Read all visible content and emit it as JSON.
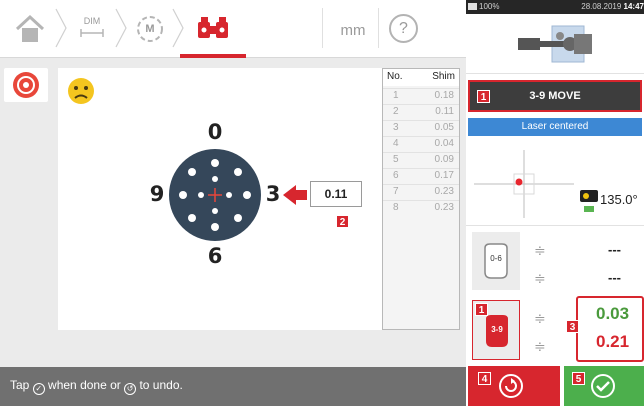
{
  "toolbar": {
    "dim_label": "DIM",
    "m_label": "M",
    "units": "mm",
    "help": "?"
  },
  "diagram": {
    "label_top": "0",
    "label_left": "9",
    "label_right": "3",
    "label_bottom": "6",
    "shim_value": "0.11",
    "badge": "2",
    "face": "frown-face-icon"
  },
  "shim_table": {
    "header_no": "No.",
    "header_shim": "Shim",
    "rows": [
      {
        "no": "1",
        "shim": "0.18"
      },
      {
        "no": "2",
        "shim": "0.11"
      },
      {
        "no": "3",
        "shim": "0.05"
      },
      {
        "no": "4",
        "shim": "0.04"
      },
      {
        "no": "5",
        "shim": "0.09"
      },
      {
        "no": "6",
        "shim": "0.17"
      },
      {
        "no": "7",
        "shim": "0.23"
      },
      {
        "no": "8",
        "shim": "0.23"
      }
    ]
  },
  "status": {
    "before": "Tap",
    "middle": "when done or",
    "after": "to undo."
  },
  "right_panel": {
    "battery": "100%",
    "datetime": "28.08.2019",
    "time": "14:47",
    "move_badge": "1",
    "move_text": "3-9 MOVE",
    "laser_status": "Laser centered",
    "angle": "135.0°",
    "row06_label": "0-6",
    "row06_val1": "---",
    "row06_val2": "---",
    "row39_badge": "1",
    "row39_label": "3-9",
    "value_badge": "3",
    "value_top": "0.03",
    "value_bottom": "0.21",
    "undo_badge": "4",
    "done_badge": "5"
  },
  "colors": {
    "accent_red": "#d7262e",
    "laser_blue": "#3d88d4",
    "done_green": "#4caf4c",
    "disk_navy": "#35475a"
  }
}
